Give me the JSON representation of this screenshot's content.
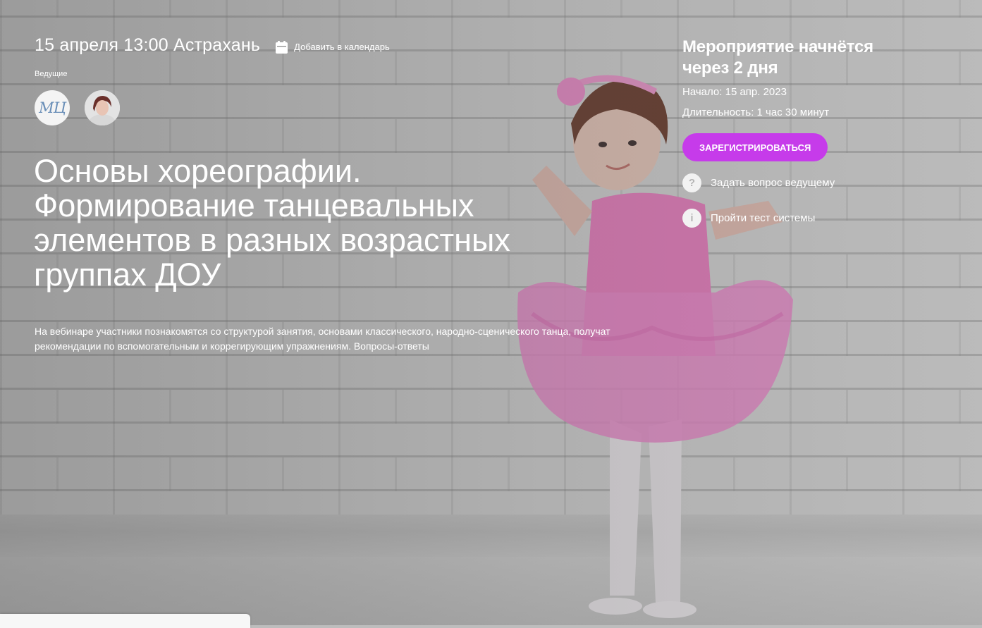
{
  "event": {
    "date_time_city": "15 апреля 13:00 Астрахань",
    "add_to_calendar": "Добавить в календарь",
    "hosts_label": "Ведущие",
    "host_logo_text": "МЦ",
    "title": "Основы хореографии. Формирование танцевальных элементов в разных возрастных группах ДОУ",
    "description": "На вебинаре участники познакомятся со структурой занятия, основами классического, народно-сценического танца, получат рекомендации по вспомогательным и коррегирующим упражнениям. Вопросы-ответы"
  },
  "panel": {
    "starts_in": "Мероприятие начнётся через 2 дня",
    "start_label": "Начало: 15 апр. 2023",
    "duration_label": "Длительность: 1 час 30 минут",
    "register_button": "Зарегистрироваться",
    "ask_question": "Задать вопрос ведущему",
    "system_test": "Пройти тест системы",
    "ask_icon_glyph": "?",
    "info_icon_glyph": "i"
  },
  "colors": {
    "accent": "#c63bea",
    "text": "#ffffff"
  },
  "icons": [
    "calendar-icon",
    "question-icon",
    "info-icon"
  ]
}
